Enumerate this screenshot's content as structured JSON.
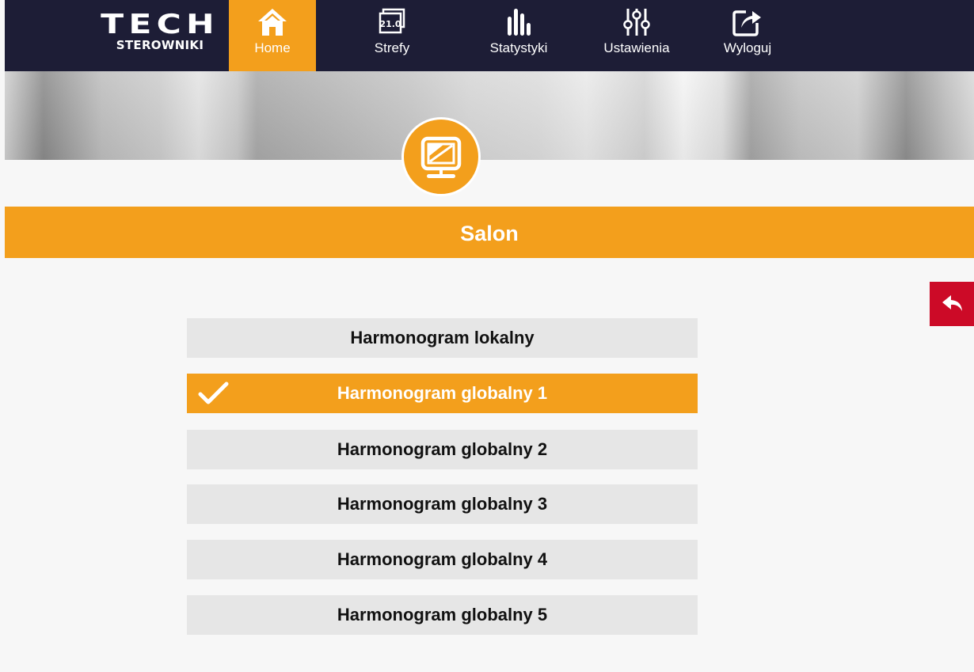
{
  "brand": {
    "logo_mark": "TECH",
    "logo_sub": "STEROWNIKI"
  },
  "nav": {
    "items": [
      {
        "label": "Home",
        "icon": "home-icon",
        "active": true
      },
      {
        "label": "Strefy",
        "icon": "zones-icon",
        "badge": "21.0",
        "active": false
      },
      {
        "label": "Statystyki",
        "icon": "statistics-icon",
        "active": false
      },
      {
        "label": "Ustawienia",
        "icon": "settings-icon",
        "active": false
      },
      {
        "label": "Wyloguj",
        "icon": "logout-icon",
        "active": false
      }
    ]
  },
  "zone": {
    "title": "Salon",
    "icon": "monitor-icon"
  },
  "schedules": [
    {
      "label": "Harmonogram lokalny",
      "selected": false
    },
    {
      "label": "Harmonogram globalny 1",
      "selected": true
    },
    {
      "label": "Harmonogram globalny 2",
      "selected": false
    },
    {
      "label": "Harmonogram globalny 3",
      "selected": false
    },
    {
      "label": "Harmonogram globalny 4",
      "selected": false
    },
    {
      "label": "Harmonogram globalny 5",
      "selected": false
    }
  ],
  "colors": {
    "accent": "#f39f1c",
    "navbar": "#1d1d36",
    "back_button": "#cc0a27",
    "list_item": "#e6e6e6",
    "background": "#f7f7f7"
  }
}
